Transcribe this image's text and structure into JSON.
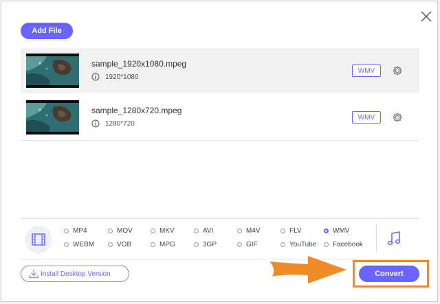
{
  "toolbar": {
    "add_file_label": "Add File"
  },
  "files": [
    {
      "name": "sample_1920x1080.mpeg",
      "resolution": "1920*1080",
      "format": "WMV"
    },
    {
      "name": "sample_1280x720.mpeg",
      "resolution": "1280*720",
      "format": "WMV"
    }
  ],
  "formats": {
    "selected": "WMV",
    "row1": [
      "MP4",
      "MOV",
      "MKV",
      "AVI",
      "M4V",
      "FLV",
      "WMV"
    ],
    "row2": [
      "WEBM",
      "VOB",
      "MPG",
      "3GP",
      "GIF",
      "YouTube",
      "Facebook"
    ]
  },
  "footer": {
    "install_label": "Install Desktop Version",
    "convert_label": "Convert"
  },
  "colors": {
    "accent": "#6c64ff",
    "highlight": "#f08a24"
  }
}
